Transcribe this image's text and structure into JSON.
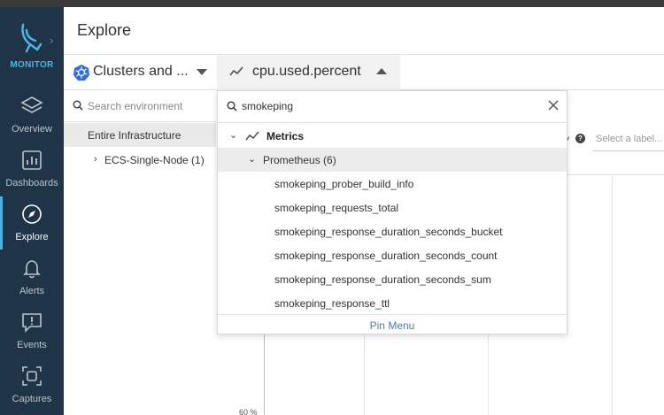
{
  "app": {
    "logo_text": "MONITOR",
    "page_title": "Explore"
  },
  "sidebar": {
    "items": [
      {
        "label": "Overview",
        "icon": "overview-icon"
      },
      {
        "label": "Dashboards",
        "icon": "dashboards-icon"
      },
      {
        "label": "Explore",
        "icon": "explore-icon",
        "active": true
      },
      {
        "label": "Alerts",
        "icon": "alerts-icon"
      },
      {
        "label": "Events",
        "icon": "events-icon"
      },
      {
        "label": "Captures",
        "icon": "captures-icon"
      }
    ]
  },
  "toolbar": {
    "cluster_label": "Clusters and ...",
    "metric_label": "cpu.used.percent"
  },
  "env_panel": {
    "search_placeholder": "Search environment",
    "entire_label": "Entire Infrastructure",
    "ecs_label": "ECS-Single-Node (1)"
  },
  "dropdown": {
    "search_value": "smokeping",
    "metrics_label": "Metrics",
    "prometheus_label": "Prometheus (6)",
    "items": [
      "smokeping_prober_build_info",
      "smokeping_requests_total",
      "smokeping_response_duration_seconds_bucket",
      "smokeping_response_duration_seconds_count",
      "smokeping_response_duration_seconds_sum",
      "smokeping_response_ttl"
    ],
    "pin_label": "Pin Menu"
  },
  "right": {
    "slash": "y",
    "label_placeholder": "Select a label...",
    "y_tick": "60 %"
  },
  "colors": {
    "sidebar_bg": "#1f3446",
    "accent": "#4fb3e0",
    "link": "#4a7ea6"
  }
}
